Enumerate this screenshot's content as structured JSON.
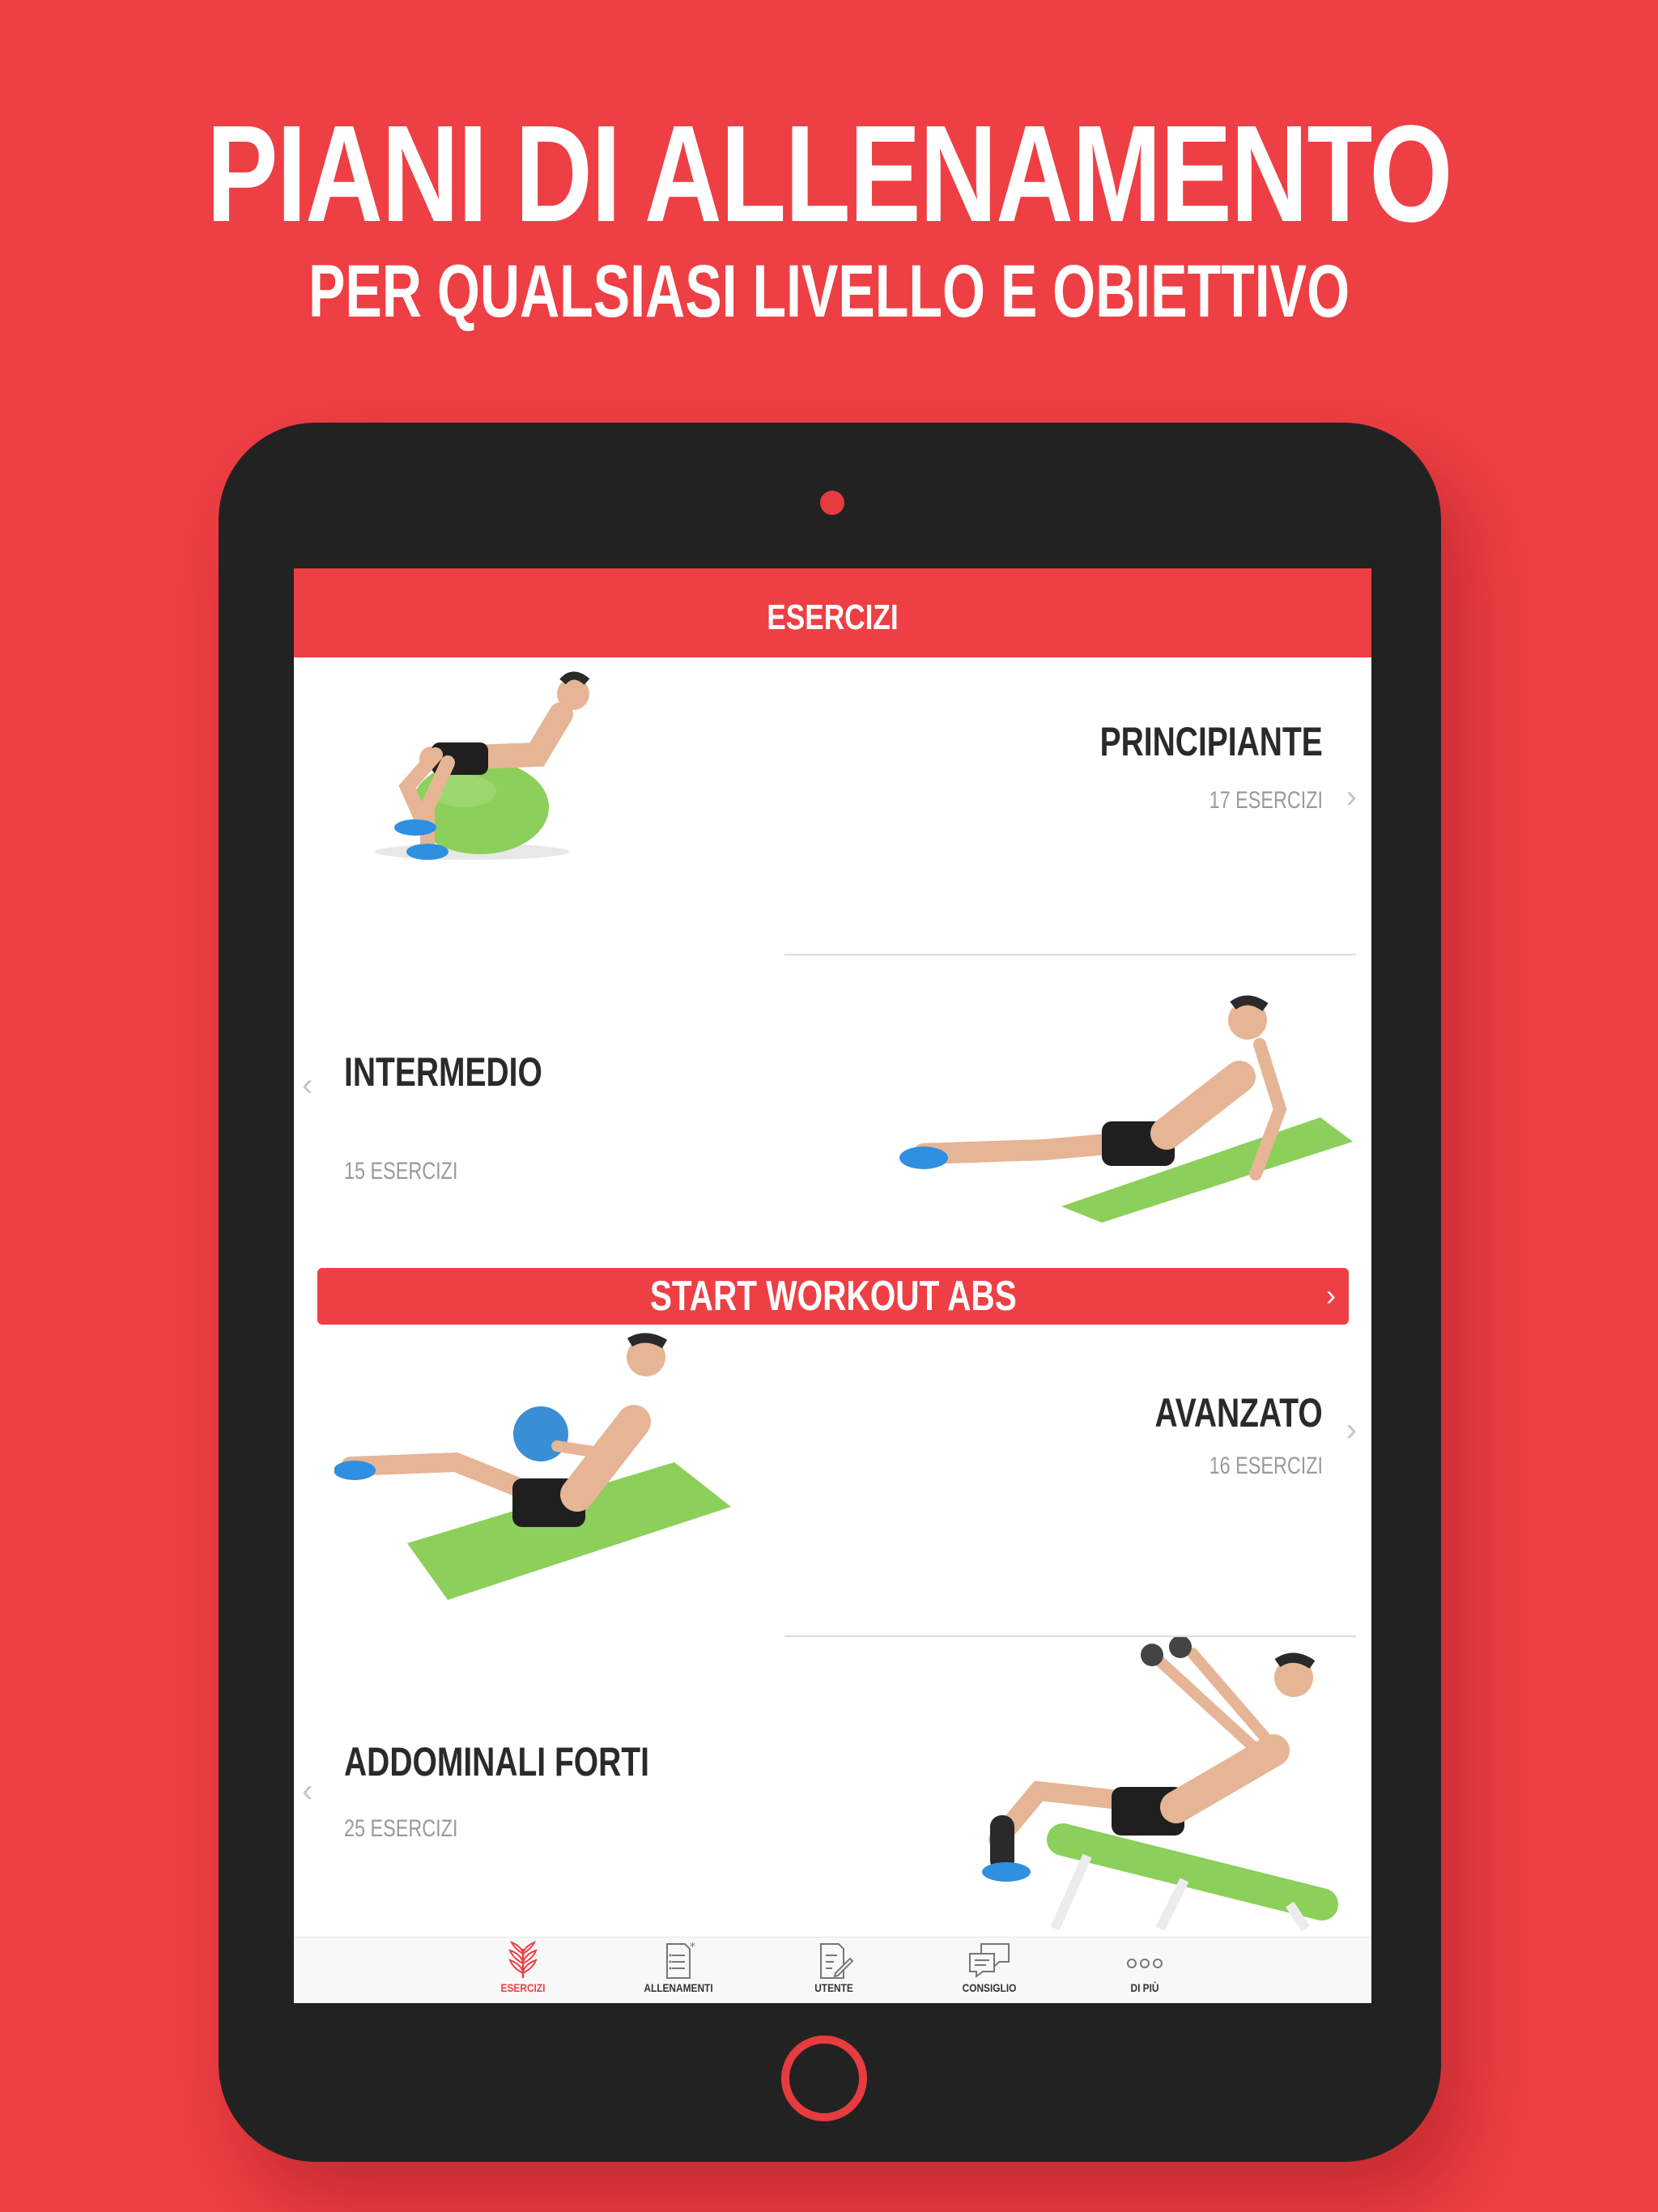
{
  "promo": {
    "title": "PIANI DI ALLENAMENTO",
    "subtitle": "PER QUALSIASI LIVELLO E OBIETTIVO"
  },
  "screen": {
    "nav_title": "ESERCIZI",
    "rows": [
      {
        "title": "PRINCIPIANTE",
        "subtitle": "17 ESERCIZI"
      },
      {
        "title": "INTERMEDIO",
        "subtitle": "15 ESERCIZI"
      },
      {
        "title": "AVANZATO",
        "subtitle": "16 ESERCIZI"
      },
      {
        "title": "ADDOMINALI FORTI",
        "subtitle": "25 ESERCIZI"
      }
    ],
    "start_button": "START WORKOUT ABS",
    "tabs": [
      {
        "label": "ESERCIZI",
        "icon": "wheat-icon",
        "active": true
      },
      {
        "label": "ALLENAMENTI",
        "icon": "document-star-icon",
        "active": false
      },
      {
        "label": "UTENTE",
        "icon": "document-pen-icon",
        "active": false
      },
      {
        "label": "CONSIGLIO",
        "icon": "chat-bubbles-icon",
        "active": false
      },
      {
        "label": "DI PIÙ",
        "icon": "more-dots-icon",
        "active": false
      }
    ]
  },
  "colors": {
    "brand_red": "#ee3f44",
    "device": "#222222",
    "mat_green": "#8ccf5a",
    "shorts": "#1f1f1f",
    "shoes": "#2f8fe0"
  }
}
